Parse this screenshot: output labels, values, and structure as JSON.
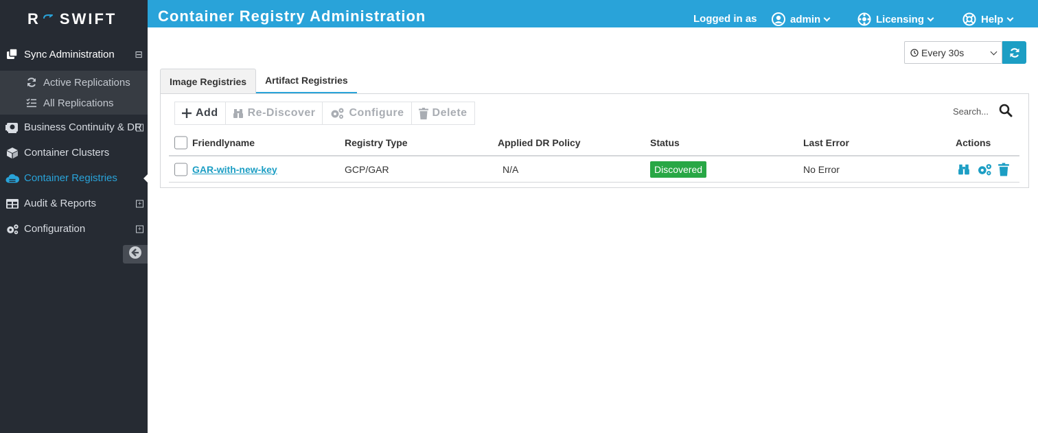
{
  "app": {
    "logo_text": "SWIFT",
    "logo_letter": "R",
    "page_title": "Container Registry Administration"
  },
  "header": {
    "logged_in_label": "Logged in as",
    "user_name": "admin",
    "licensing_label": "Licensing",
    "help_label": "Help"
  },
  "sidebar": {
    "sync_admin": "Sync Administration",
    "sync_collapse": "⊟",
    "sub_items": [
      {
        "label": "Active Replications",
        "icon": "sync-icon"
      },
      {
        "label": "All Replications",
        "icon": "list-icon"
      }
    ],
    "items": [
      {
        "label": "Business Continuity & DR",
        "icon": "dr-icon",
        "expand": "+"
      },
      {
        "label": "Container Clusters",
        "icon": "cube-icon",
        "expand": ""
      },
      {
        "label": "Container Registries",
        "icon": "cloud-icon",
        "expand": "",
        "active": true
      },
      {
        "label": "Audit & Reports",
        "icon": "table-icon",
        "expand": "+"
      },
      {
        "label": "Configuration",
        "icon": "gears-icon",
        "expand": "+"
      }
    ]
  },
  "controls": {
    "refresh_interval": "Every 30s"
  },
  "tabs": [
    {
      "label": "Image Registries",
      "active": false
    },
    {
      "label": "Artifact Registries",
      "active": true
    }
  ],
  "toolbar": {
    "add": "Add",
    "rediscover": "Re-Discover",
    "configure": "Configure",
    "delete": "Delete"
  },
  "search": {
    "placeholder": "Search..."
  },
  "table": {
    "columns": [
      "Friendlyname",
      "Registry Type",
      "Applied DR Policy",
      "Status",
      "Last Error",
      "Actions"
    ],
    "rows": [
      {
        "friendlyname": "GAR-with-new-key",
        "registry_type": "GCP/GAR",
        "dr_policy": "N/A",
        "status": "Discovered",
        "last_error": "No Error"
      }
    ]
  },
  "colors": {
    "brand": "#29a3d9",
    "sidebar_bg": "#262b33",
    "status_ok": "#28a745"
  }
}
